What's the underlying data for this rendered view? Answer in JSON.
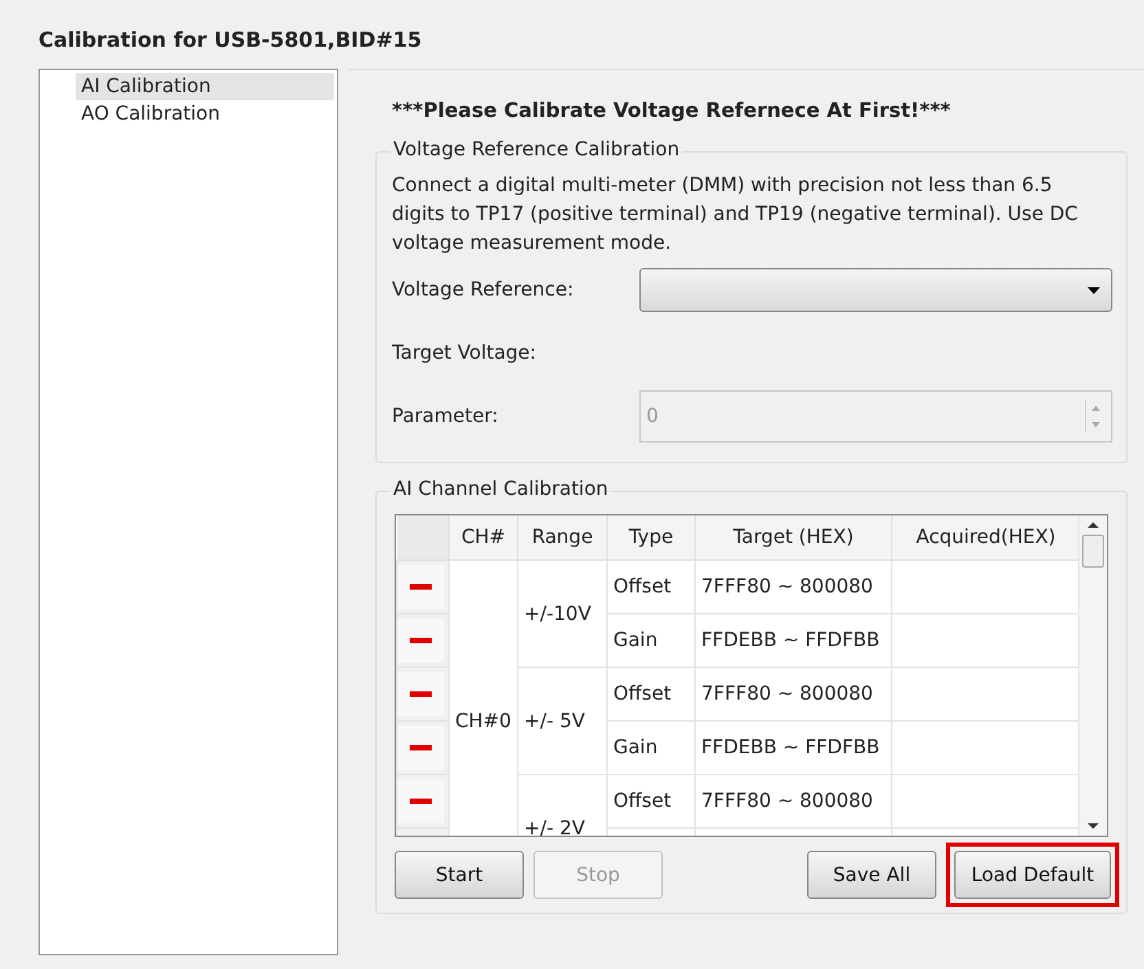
{
  "window": {
    "title": "Calibration for USB-5801,BID#15"
  },
  "sidebar": {
    "items": [
      {
        "label": "AI Calibration",
        "selected": true
      },
      {
        "label": "AO Calibration",
        "selected": false
      }
    ]
  },
  "heading": "***Please Calibrate Voltage Refernece At First!***",
  "voltage_reference": {
    "title": "Voltage Reference Calibration",
    "instructions": "Connect a digital multi-meter (DMM) with precision not less than 6.5 digits to TP17 (positive terminal) and TP19 (negative terminal). Use DC voltage measurement mode.",
    "reference_label": "Voltage Reference:",
    "target_label": "Target Voltage:",
    "parameter_label": "Parameter:",
    "parameter_value": "0",
    "parameter_disabled": true
  },
  "channel_calibration": {
    "title": "AI Channel Calibration",
    "columns": [
      "CH#",
      "Range",
      "Type",
      "Target (HEX)",
      "Acquired(HEX)"
    ],
    "channels": [
      {
        "name": "CH#0",
        "ranges": [
          {
            "label": "+/-10V",
            "types": [
              {
                "type": "Offset",
                "target": "7FFF80 ~ 800080"
              },
              {
                "type": "Gain",
                "target": "FFDEBB ~ FFDFBB"
              }
            ]
          },
          {
            "label": "+/- 5V",
            "types": [
              {
                "type": "Offset",
                "target": "7FFF80 ~ 800080"
              },
              {
                "type": "Gain",
                "target": "FFDEBB ~ FFDFBB"
              }
            ]
          },
          {
            "label": "+/- 2V",
            "types": [
              {
                "type": "Offset",
                "target": "7FFF80 ~ 800080"
              }
            ]
          }
        ]
      }
    ]
  },
  "buttons_left": [
    {
      "label": "Start",
      "disabled": false
    },
    {
      "label": "Stop",
      "disabled": true
    }
  ],
  "buttons_right": [
    {
      "label": "Save All",
      "disabled": false,
      "highlighted": false
    },
    {
      "label": "Load Default",
      "disabled": false,
      "highlighted": true
    }
  ]
}
